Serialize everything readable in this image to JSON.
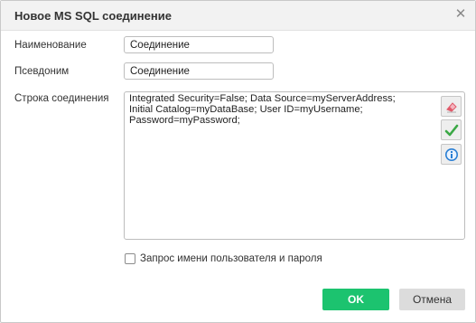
{
  "dialog": {
    "title": "Новое MS SQL соединение",
    "close_icon": "close-icon"
  },
  "form": {
    "name_label": "Наименование",
    "name_value": "Соединение",
    "alias_label": "Псевдоним",
    "alias_value": "Соединение",
    "connstr_label": "Строка соединения",
    "connstr_value": "Integrated Security=False; Data Source=myServerAddress;\nInitial Catalog=myDataBase; User ID=myUsername;\nPassword=myPassword;",
    "side_buttons": [
      "eraser-icon",
      "check-icon",
      "info-icon"
    ],
    "prompt_checkbox_label": "Запрос имени пользователя и пароля",
    "prompt_checkbox_checked": false
  },
  "buttons": {
    "ok_label": "OK",
    "cancel_label": "Отмена"
  },
  "colors": {
    "ok": "#1cc36f",
    "cancel": "#dcdcdc",
    "check_icon": "#3aa845",
    "info_icon": "#2a7fd4",
    "eraser_icon": "#e05a6a"
  }
}
